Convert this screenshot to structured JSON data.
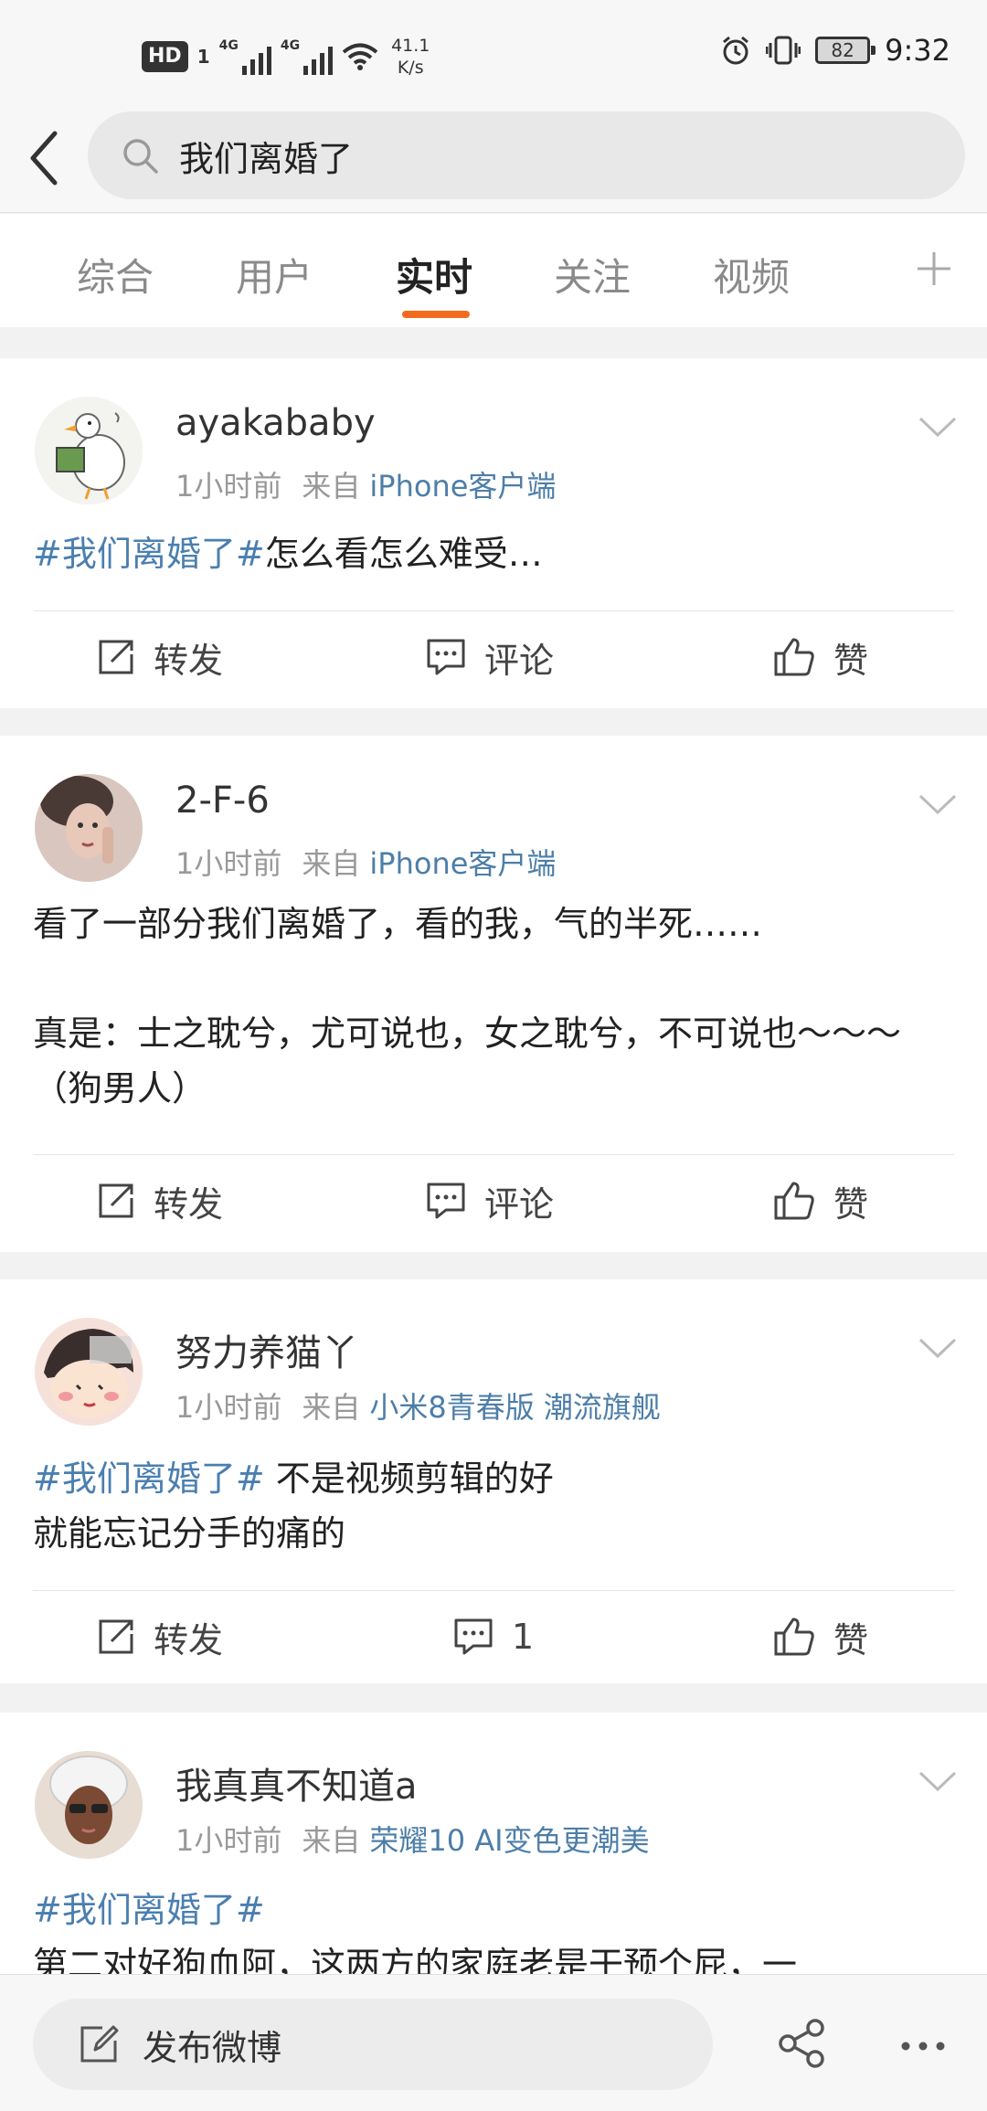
{
  "status_bar": {
    "hd": "HD",
    "sim1": "1",
    "net1": "4G",
    "net2": "4G",
    "speed_value": "41.1",
    "speed_unit": "K/s",
    "battery": "82",
    "time": "9:32"
  },
  "search": {
    "query": "我们离婚了"
  },
  "tabs": [
    {
      "label": "综合",
      "active": false
    },
    {
      "label": "用户",
      "active": false
    },
    {
      "label": "实时",
      "active": true
    },
    {
      "label": "关注",
      "active": false
    },
    {
      "label": "视频",
      "active": false
    }
  ],
  "posts": [
    {
      "user": "ayakababy",
      "time": "1小时前",
      "from": "来自",
      "source": "iPhone客户端",
      "tag": "#我们离婚了#",
      "text": "怎么看怎么难受…",
      "actions": {
        "repost": "转发",
        "comment": "评论",
        "like": "赞"
      }
    },
    {
      "user": "2-F-6",
      "time": "1小时前",
      "from": "来自",
      "source": "iPhone客户端",
      "tag": "",
      "text": "看了一部分我们离婚了，看的我，气的半死……\n\n真是：士之耽兮，尤可说也，女之耽兮，不可说也～～～（狗男人）",
      "actions": {
        "repost": "转发",
        "comment": "评论",
        "like": "赞"
      }
    },
    {
      "user": "努力养猫丫",
      "time": "1小时前",
      "from": "来自",
      "source": "小米8青春版 潮流旗舰",
      "tag": "#我们离婚了#",
      "text": " 不是视频剪辑的好\n就能忘记分手的痛的",
      "actions": {
        "repost": "转发",
        "comment": "1",
        "like": "赞"
      }
    },
    {
      "user": "我真真不知道a",
      "time": "1小时前",
      "from": "来自",
      "source": "荣耀10 AI变色更潮美",
      "tag": "#我们离婚了#",
      "text": "\n第二对好狗血阿，这两方的家庭老是干预个屁，一",
      "actions": {}
    }
  ],
  "bottom_bar": {
    "compose": "发布微博"
  },
  "colors": {
    "accent": "#f26b1d",
    "link": "#4a7fb0",
    "source": "#4d7ea8"
  }
}
